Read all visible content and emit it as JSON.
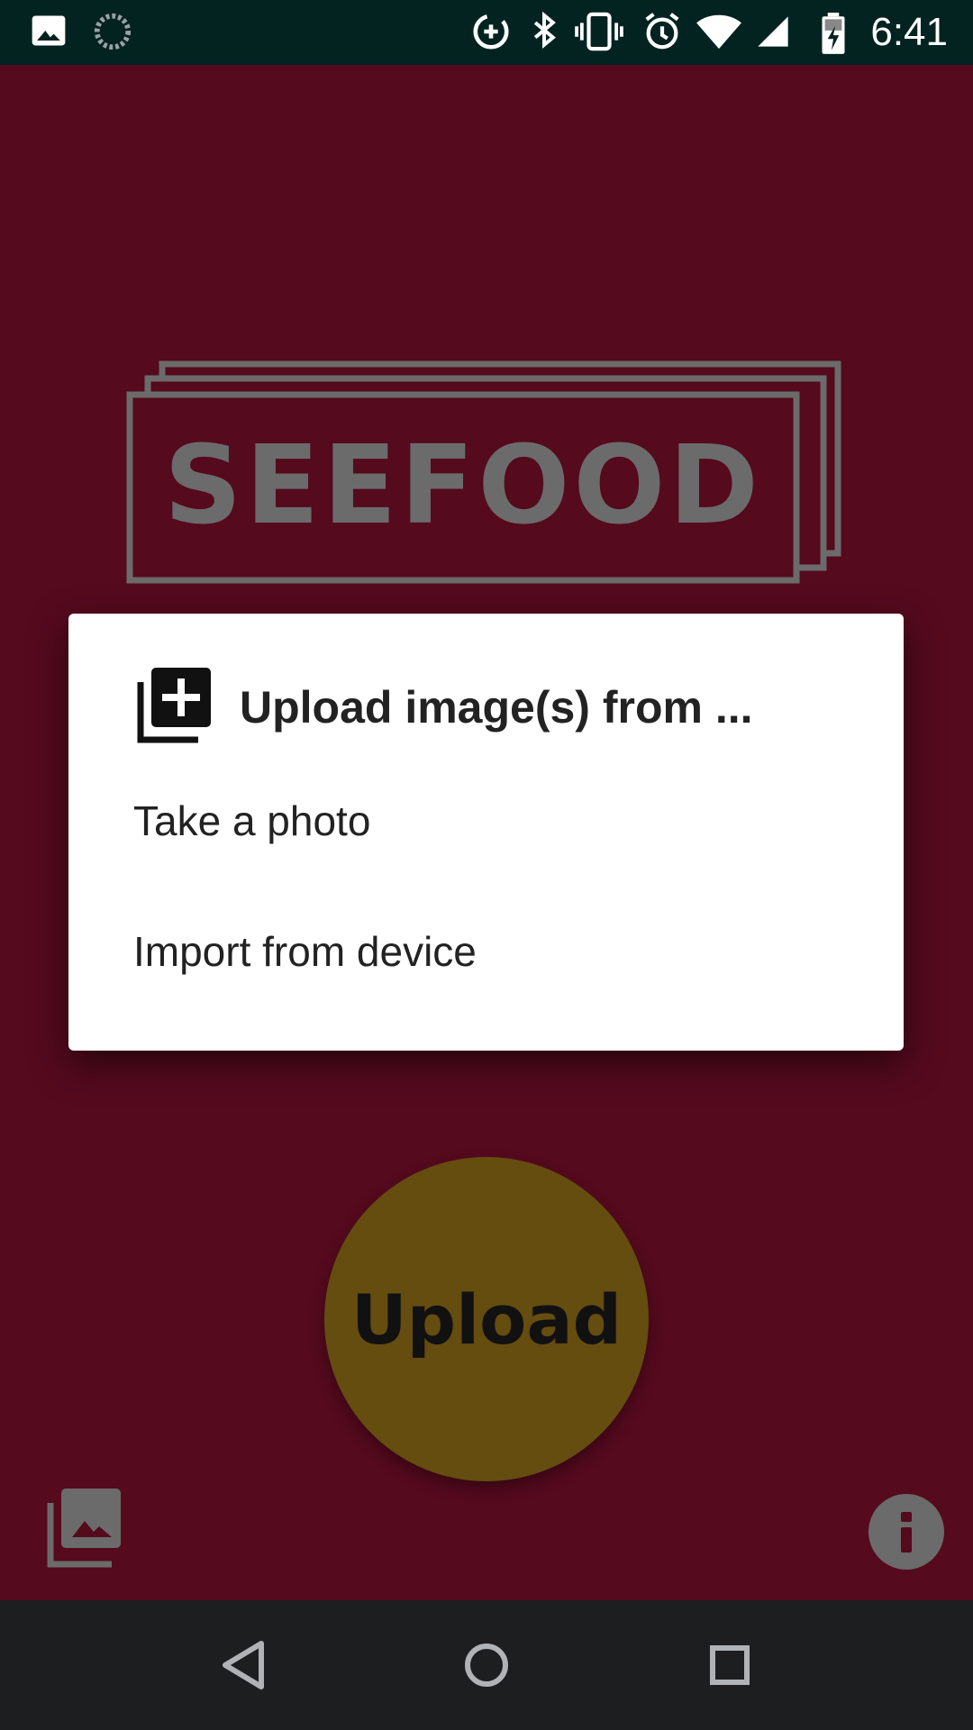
{
  "status_bar": {
    "time": "6:41",
    "left_icons": [
      "image-notification-icon",
      "sync-progress-icon"
    ],
    "right_icons": [
      "data-saver-icon",
      "bluetooth-icon",
      "vibrate-icon",
      "alarm-icon",
      "wifi-icon",
      "cell-signal-icon",
      "battery-charging-icon"
    ]
  },
  "app": {
    "logo_text": "SEEFOOD",
    "upload_label": "Upload",
    "colors": {
      "background": "#550a1e",
      "upload_button": "#654c0f",
      "logo": "#6b6b6b"
    }
  },
  "dialog": {
    "title": "Upload image(s) from ...",
    "icon": "add-to-library-icon",
    "options": [
      {
        "label": "Take a photo"
      },
      {
        "label": "Import from device"
      }
    ]
  },
  "bottom_bar": {
    "gallery_icon": "photo-library-icon",
    "info_icon": "info-icon"
  },
  "nav_bar": {
    "icons": [
      "back-icon",
      "home-icon",
      "recents-icon"
    ]
  }
}
